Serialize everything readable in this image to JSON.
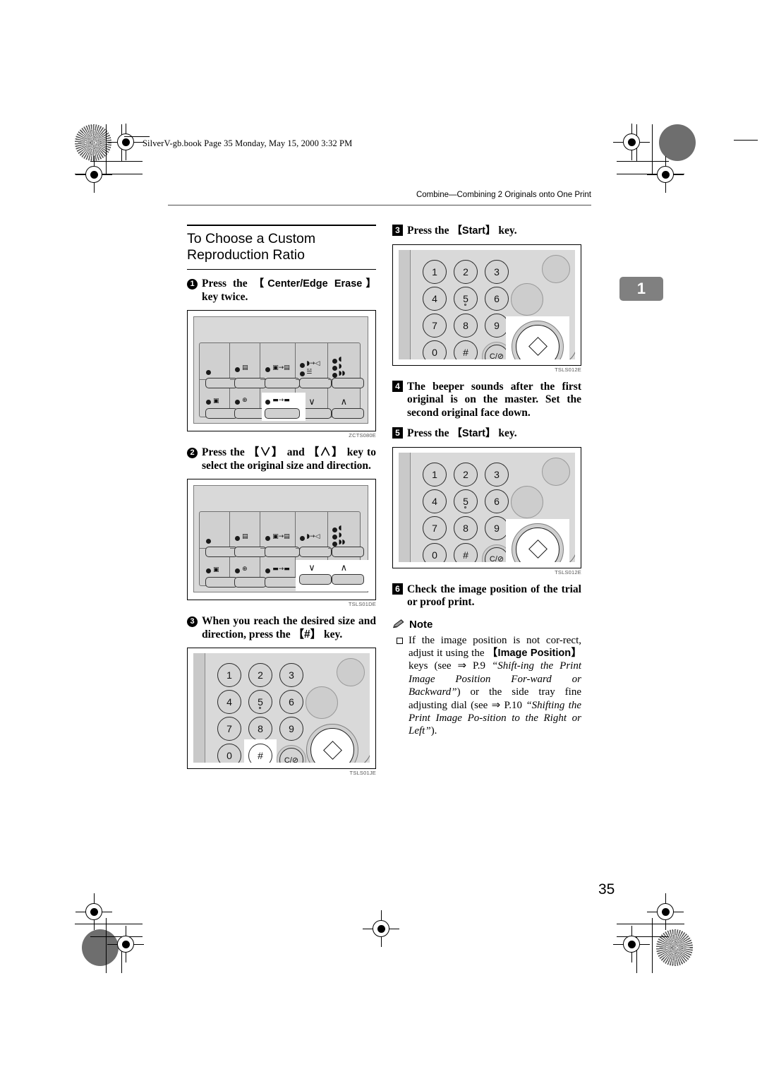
{
  "page": {
    "book_line": "SilverV-gb.book  Page 35  Monday, May 15, 2000  3:32 PM",
    "running_head": "Combine—Combining 2 Originals onto One Print",
    "chapter_tab": "1",
    "page_number": "35"
  },
  "left_column": {
    "section_title": "To Choose a Custom Reproduction Ratio",
    "steps": [
      {
        "number": "1",
        "text_parts": [
          {
            "t": "Press   the   ",
            "style": "bold"
          },
          {
            "t": "【Center/Edge  Erase】",
            "style": "key"
          },
          {
            "t": " key twice.",
            "style": "bold"
          }
        ]
      },
      {
        "number": "2",
        "text_parts": [
          {
            "t": "Press the ",
            "style": "bold"
          },
          {
            "t": "【∨】",
            "style": "key"
          },
          {
            "t": " and ",
            "style": "bold"
          },
          {
            "t": "【∧】",
            "style": "key"
          },
          {
            "t": " key to select the original size and direction.",
            "style": "bold"
          }
        ]
      },
      {
        "number": "3",
        "text_parts": [
          {
            "t": "When  you  reach  the  desired size  and  direction,  press  the ",
            "style": "bold"
          },
          {
            "t": "【#】",
            "style": "key"
          },
          {
            "t": " key.",
            "style": "bold"
          }
        ]
      }
    ],
    "figures": [
      {
        "caption": "ZCTS080E",
        "kind": "control-panel",
        "highlight": "combine-key"
      },
      {
        "caption": "TSLS01DE",
        "kind": "control-panel",
        "highlight": "arrow-keys"
      },
      {
        "caption": "TSLS01JE",
        "kind": "keypad",
        "highlight": "hash-key"
      }
    ]
  },
  "right_column": {
    "steps": [
      {
        "number": "3",
        "text_parts": [
          {
            "t": "Press the ",
            "style": "bold"
          },
          {
            "t": "【Start】",
            "style": "key"
          },
          {
            "t": " key.",
            "style": "bold"
          }
        ]
      },
      {
        "number": "4",
        "text_parts": [
          {
            "t": "The  beeper  sounds  after  the  first original  is  on  the  master.  Set  the second original face down.",
            "style": "bold"
          }
        ]
      },
      {
        "number": "5",
        "text_parts": [
          {
            "t": "Press the ",
            "style": "bold"
          },
          {
            "t": "【Start】",
            "style": "key"
          },
          {
            "t": " key.",
            "style": "bold"
          }
        ]
      },
      {
        "number": "6",
        "text_parts": [
          {
            "t": "Check  the  image  position  of  the trial or proof print.",
            "style": "bold"
          }
        ]
      }
    ],
    "figures": [
      {
        "caption": "TSLS012E",
        "kind": "keypad",
        "highlight": "start-key"
      },
      {
        "caption": "TSLS012E",
        "kind": "keypad",
        "highlight": "start-key"
      }
    ],
    "note": {
      "label": "Note",
      "items": [
        {
          "parts": [
            {
              "t": "If the image position is not cor-rect,  adjust  it  using  the ",
              "style": "roman"
            },
            {
              "t": "【Image Position】",
              "style": "key"
            },
            {
              "t": " keys (see ⇒ P.9 ",
              "style": "roman"
            },
            {
              "t": "“Shift-ing the Print Image Position For-ward or Backward”",
              "style": "italic"
            },
            {
              "t": ") or the side tray  fine  adjusting  dial  (see ⇒ P.10 ",
              "style": "roman"
            },
            {
              "t": "“Shifting the Print Image Po-sition to the Right or Left”",
              "style": "italic"
            },
            {
              "t": ").",
              "style": "roman"
            }
          ]
        }
      ]
    }
  },
  "keypad": {
    "keys": [
      "1",
      "2",
      "3",
      "4",
      "5",
      "6",
      "7",
      "8",
      "9",
      "0",
      "#"
    ],
    "clear_key": "C/⊘",
    "start_key_icon": "start-diamond-icon",
    "paper_keys": [
      "paper-feed-icon",
      "paper-size-icon"
    ]
  },
  "control_panel": {
    "indicator_icons": [
      "plain-led",
      "original-type-icon",
      "size-convert-icon",
      "speed-icon",
      "density-icon",
      "memory-icon",
      "position-icon",
      "combine-icon",
      "down-arrow",
      "up-arrow"
    ]
  }
}
